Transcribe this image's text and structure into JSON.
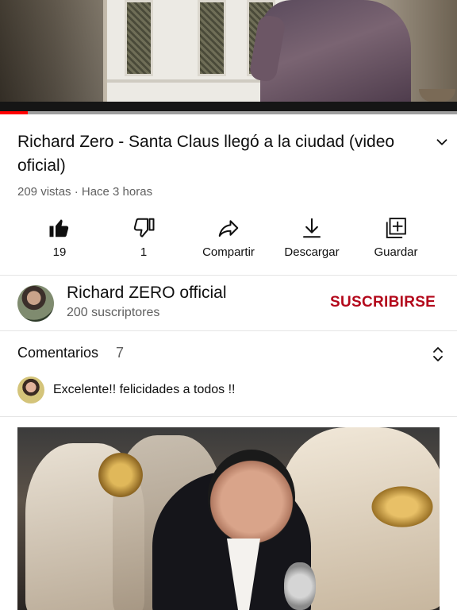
{
  "video": {
    "progress_fraction": 0.06,
    "title": "Richard Zero - Santa Claus llegó a la ciudad (video oficial)",
    "meta": "209 vistas · Hace 3 horas"
  },
  "actions": [
    {
      "icon": "thumbs-up-icon",
      "label": "19"
    },
    {
      "icon": "thumbs-down-icon",
      "label": "1"
    },
    {
      "icon": "share-icon",
      "label": "Compartir"
    },
    {
      "icon": "download-icon",
      "label": "Descargar"
    },
    {
      "icon": "save-to-playlist-icon",
      "label": "Guardar"
    }
  ],
  "channel": {
    "name": "Richard ZERO official",
    "subscribers": "200 suscriptores",
    "subscribe_label": "SUSCRIBIRSE"
  },
  "comments": {
    "title": "Comentarios",
    "count": "7",
    "first_comment": "Excelente!! felicidades a todos !!"
  },
  "colors": {
    "accent_red": "#ff0000",
    "subscribe_red": "#b3081b",
    "secondary_text": "#606060"
  }
}
